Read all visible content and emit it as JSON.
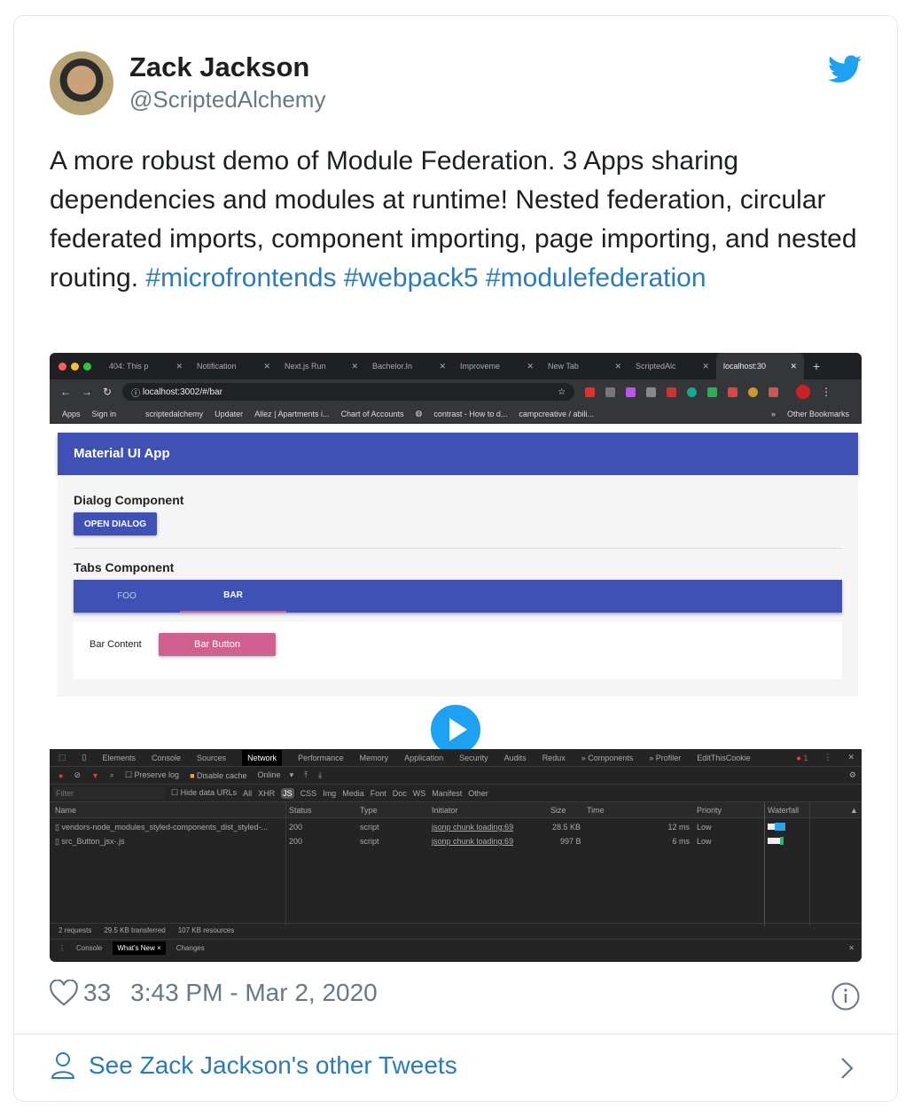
{
  "tweet": {
    "name": "Zack Jackson",
    "handle": "@ScriptedAlchemy",
    "text": "A more robust demo of Module Federation. 3 Apps sharing dependencies and modules at runtime! Nested federation, circular federated imports, component importing, page importing, and nested routing.",
    "hashtags": [
      "#microfrontends",
      "#webpack5",
      "#modulefederation"
    ],
    "likes": "33",
    "timestamp": "3:43 PM - Mar 2, 2020",
    "more_link": "See Zack Jackson's other Tweets"
  },
  "colors": {
    "link": "#2b7bb9",
    "twitter": "#1da1f2",
    "appbar": "#3f51b5",
    "accent": "#d0608f"
  },
  "browser": {
    "tabs": [
      "404: This p",
      "Notification",
      "Next.js Run",
      "Bachelor.In",
      "Improveme",
      "New Tab",
      "ScriptedAlc",
      "localhost:30"
    ],
    "url": "localhost:3002/#/bar",
    "bookmarks": [
      "Apps",
      "Sign in",
      "scriptedalchemy",
      "Updater",
      "Allez | Apartments i...",
      "Chart of Accounts",
      "contrast - How to d...",
      "campcreative / abili..."
    ],
    "other_bookmarks": "Other Bookmarks"
  },
  "app": {
    "title": "Material UI App",
    "dialog_heading": "Dialog Component",
    "open_dialog": "OPEN DIALOG",
    "tabs_heading": "Tabs Component",
    "tabs": [
      "FOO",
      "BAR"
    ],
    "bar_content": "Bar Content",
    "bar_button": "Bar Button"
  },
  "devtools": {
    "panels": [
      "Elements",
      "Console",
      "Sources",
      "Network",
      "Performance",
      "Memory",
      "Application",
      "Security",
      "Audits",
      "Redux",
      "» Components",
      "» Profiler",
      "EditThisCookie"
    ],
    "error_count": "1",
    "preserve_log": "Preserve log",
    "disable_cache": "Disable cache",
    "throttle": "Online",
    "filter_placeholder": "Filter",
    "hide_data_urls": "Hide data URLs",
    "filters": [
      "All",
      "XHR",
      "JS",
      "CSS",
      "Img",
      "Media",
      "Font",
      "Doc",
      "WS",
      "Manifest",
      "Other"
    ],
    "columns": [
      "Name",
      "Status",
      "Type",
      "Initiator",
      "Size",
      "Time",
      "Priority",
      "Waterfall"
    ],
    "rows": [
      {
        "name": "vendors-node_modules_styled-components_dist_styled-...",
        "status": "200",
        "type": "script",
        "initiator": "jsonp chunk loading:69",
        "size": "28.5 KB",
        "time": "12 ms",
        "priority": "Low"
      },
      {
        "name": "src_Button_jsx-.js",
        "status": "200",
        "type": "script",
        "initiator": "jsonp chunk loading:69",
        "size": "997 B",
        "time": "6 ms",
        "priority": "Low"
      }
    ],
    "summary": [
      "2 requests",
      "29.5 KB transferred",
      "107 KB resources"
    ],
    "drawer_tabs": [
      "Console",
      "What's New",
      "Changes"
    ]
  }
}
